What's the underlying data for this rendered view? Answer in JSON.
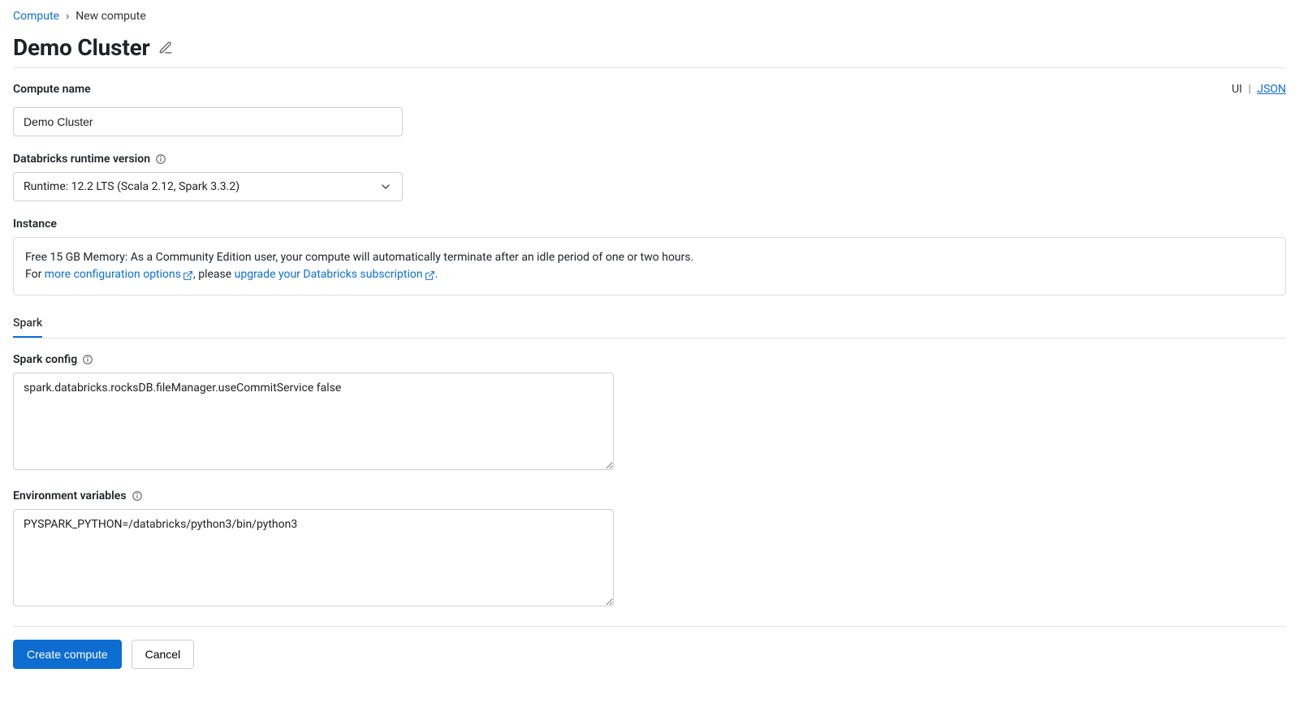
{
  "breadcrumb": {
    "parent": "Compute",
    "current": "New compute"
  },
  "title": "Demo Cluster",
  "view_toggle": {
    "ui": "UI",
    "json": "JSON"
  },
  "compute_name": {
    "label": "Compute name",
    "value": "Demo Cluster"
  },
  "runtime": {
    "label": "Databricks runtime version",
    "selected": "Runtime: 12.2 LTS (Scala 2.12, Spark 3.3.2)"
  },
  "instance": {
    "label": "Instance",
    "text_before": "Free 15 GB Memory: As a Community Edition user, your compute will automatically terminate after an idle period of one or two hours.",
    "for_text": "For ",
    "link1": "more configuration options",
    "mid_text": ", please ",
    "link2": "upgrade your Databricks subscription",
    "end_text": "."
  },
  "tabs": {
    "spark": "Spark"
  },
  "spark_config": {
    "label": "Spark config",
    "value": "spark.databricks.rocksDB.fileManager.useCommitService false"
  },
  "env_vars": {
    "label": "Environment variables",
    "value": "PYSPARK_PYTHON=/databricks/python3/bin/python3"
  },
  "buttons": {
    "create": "Create compute",
    "cancel": "Cancel"
  }
}
